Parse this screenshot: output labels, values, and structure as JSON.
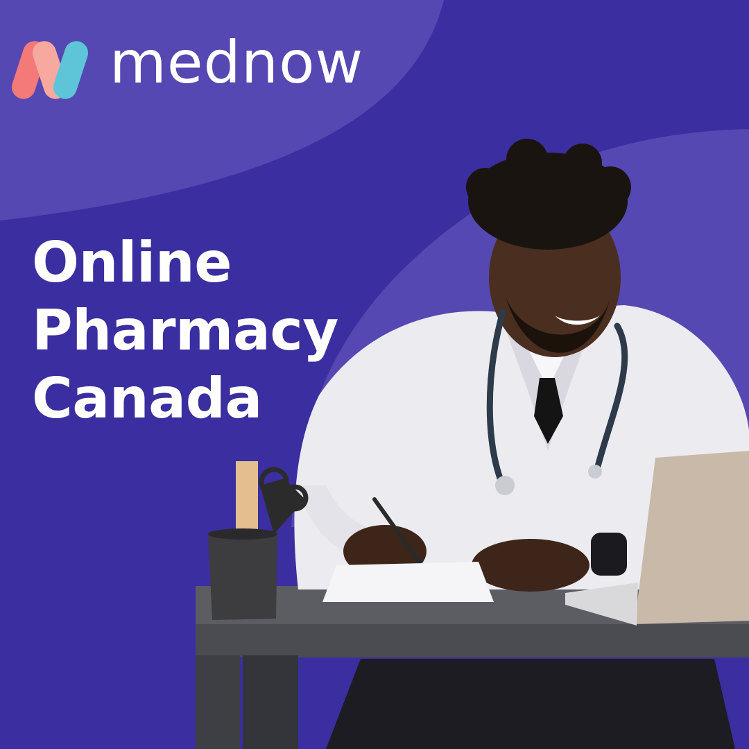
{
  "brand": {
    "name": "mednow",
    "logo_colors": [
      "#f47a7a",
      "#f7a9a0",
      "#5ec4d8"
    ]
  },
  "headline": {
    "lines": [
      "Online",
      "Pharmacy",
      "Canada"
    ]
  },
  "photo": {
    "icon": "doctor-at-desk-photo"
  },
  "colors": {
    "background": "#3a2ea0",
    "wave": "#5548b2",
    "text": "#ffffff"
  }
}
